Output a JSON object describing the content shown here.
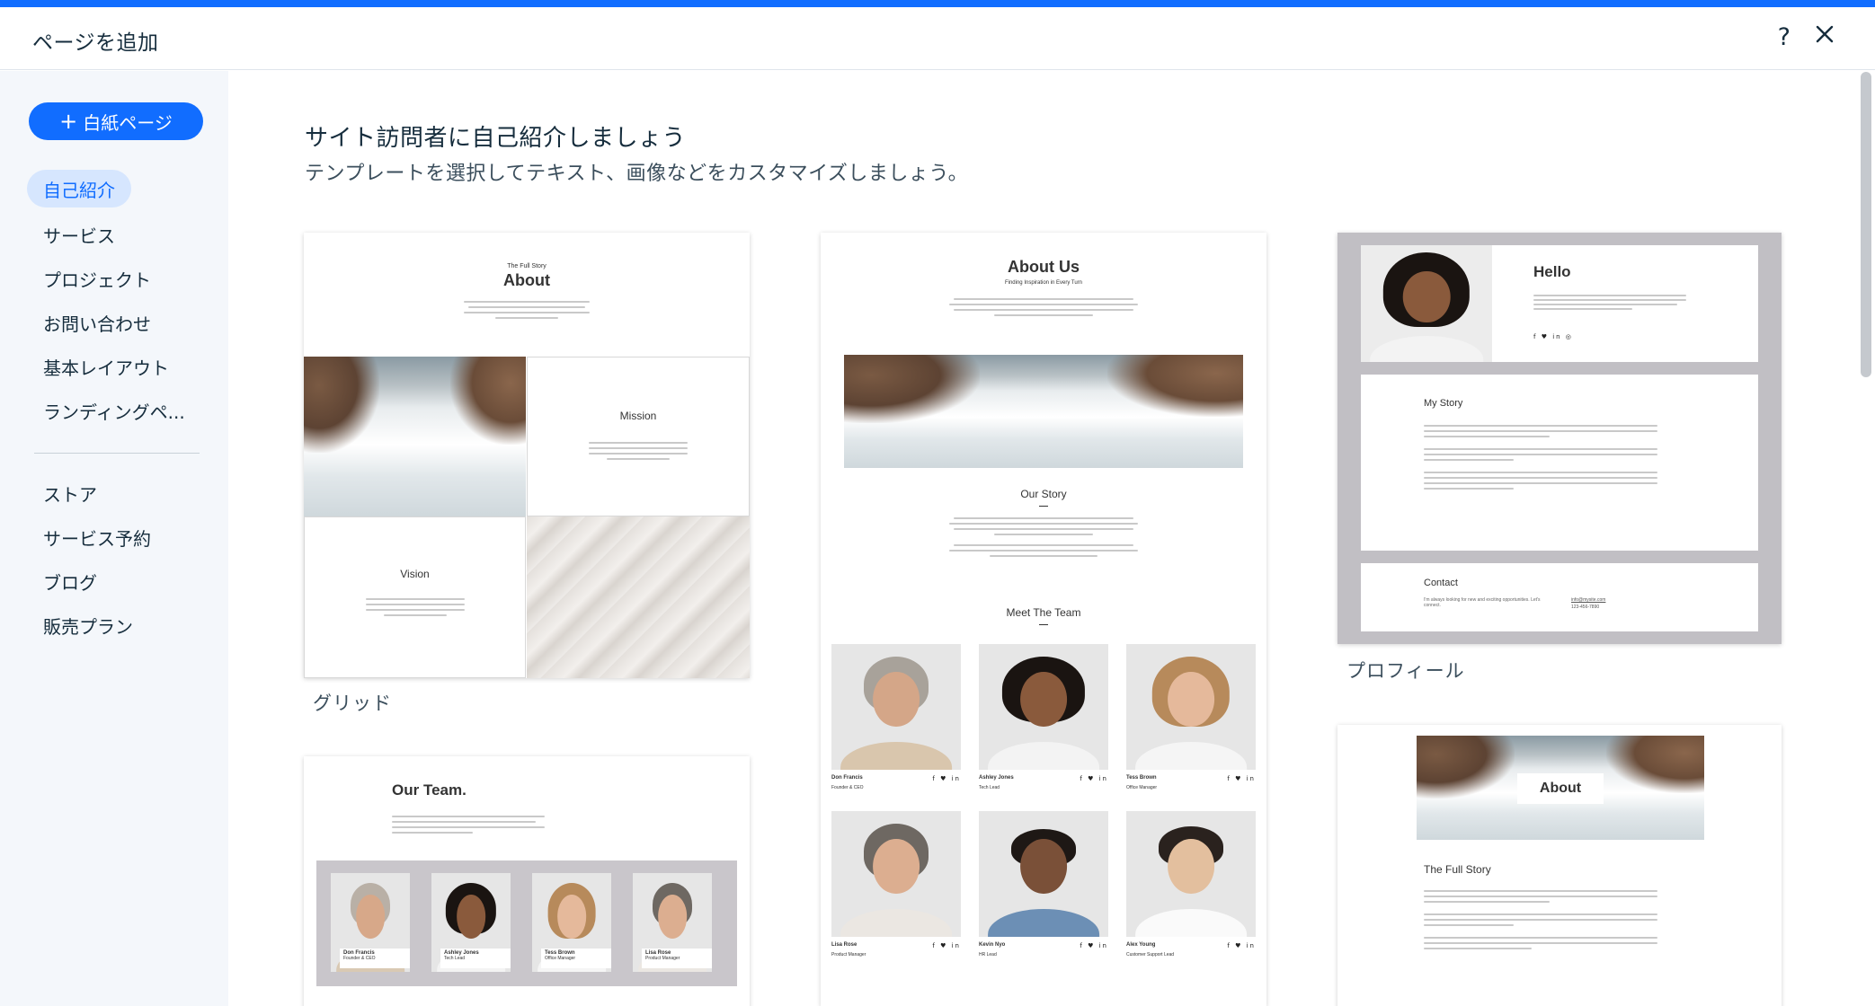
{
  "dialog": {
    "title": "ページを追加",
    "help_label": "?",
    "close_label": "close"
  },
  "sidebar": {
    "new_page_label": "白紙ページ",
    "new_page_plus": "+",
    "items": [
      {
        "label": "自己紹介"
      },
      {
        "label": "サービス"
      },
      {
        "label": "プロジェクト"
      },
      {
        "label": "お問い合わせ"
      },
      {
        "label": "基本レイアウト"
      },
      {
        "label": "ランディングペ..."
      }
    ],
    "items2": [
      {
        "label": "ストア"
      },
      {
        "label": "サービス予約"
      },
      {
        "label": "ブログ"
      },
      {
        "label": "販売プラン"
      }
    ]
  },
  "main": {
    "heading": "サイト訪問者に自己紹介しましょう",
    "subheading": "テンプレートを選択してテキスト、画像などをカスタマイズしましょう。"
  },
  "templates": {
    "grid": {
      "label": "グリッド",
      "kicker": "The Full Story",
      "title": "About",
      "mission": "Mission",
      "vision": "Vision"
    },
    "about_us": {
      "title": "About Us",
      "tagline": "Finding Inspiration in Every Turn",
      "our_story": "Our Story",
      "meet_team": "Meet The Team",
      "members": [
        {
          "name": "Don Francis",
          "role": "Founder & CEO"
        },
        {
          "name": "Ashley Jones",
          "role": "Tech Lead"
        },
        {
          "name": "Tess Brown",
          "role": "Office Manager"
        },
        {
          "name": "Lisa Rose",
          "role": "Product Manager"
        },
        {
          "name": "Kevin Nyo",
          "role": "HR Lead"
        },
        {
          "name": "Alex Young",
          "role": "Customer Support Lead"
        }
      ],
      "social": "f ♥ in"
    },
    "profile": {
      "label": "プロフィール",
      "hello": "Hello",
      "my_story": "My Story",
      "contact": "Contact",
      "contact_text": "I'm always looking for new and exciting opportunities. Let's connect.",
      "email": "info@mysite.com",
      "phone": "123-456-7890",
      "social": "f ♥ in ◎"
    },
    "our_team": {
      "title": "Our Team.",
      "members": [
        {
          "name": "Don Francis",
          "role": "Founder & CEO"
        },
        {
          "name": "Ashley Jones",
          "role": "Tech Lead"
        },
        {
          "name": "Tess Brown",
          "role": "Office Manager"
        },
        {
          "name": "Lisa Rose",
          "role": "Product Manager"
        }
      ]
    },
    "about_story": {
      "title": "About",
      "full_story": "The Full Story"
    }
  },
  "colors": {
    "accent": "#116dff",
    "sidebar_bg": "#f4f7fb",
    "active_bg": "#d6e6fe"
  }
}
